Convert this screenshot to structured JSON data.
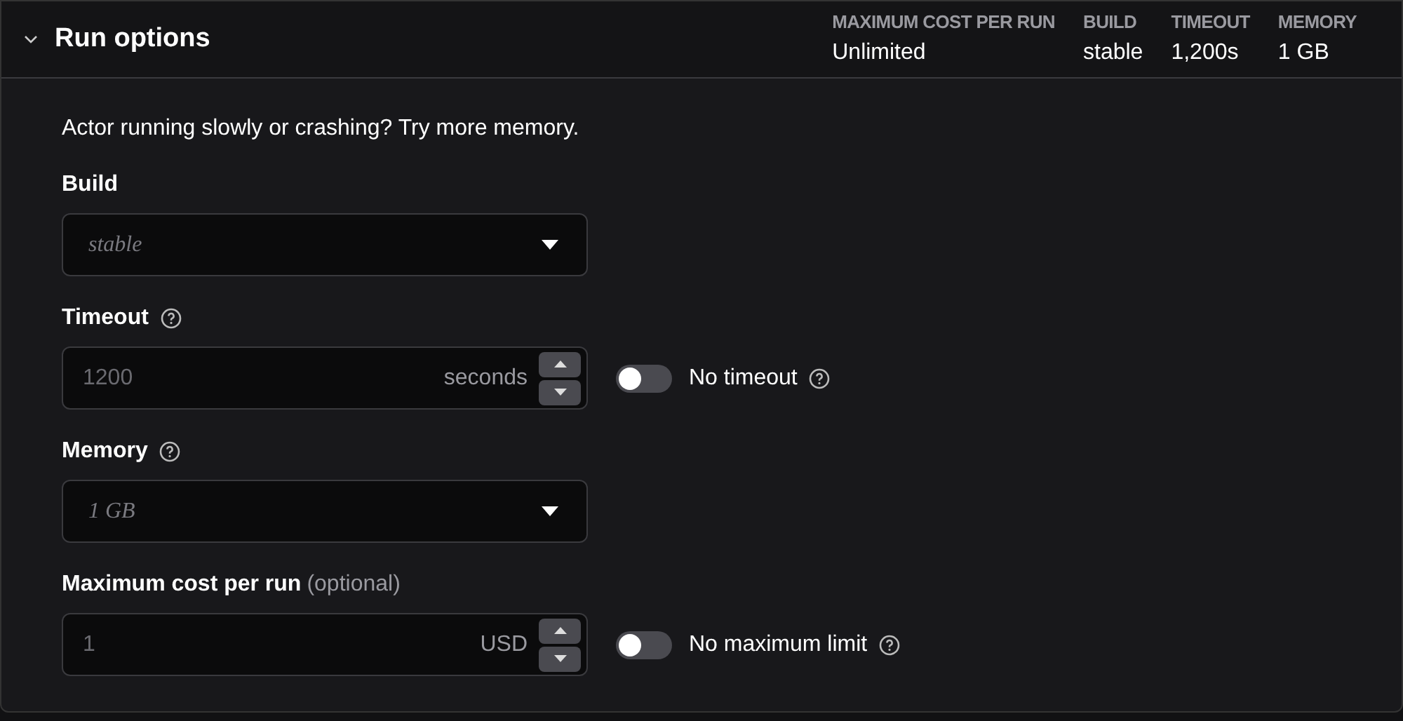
{
  "section": {
    "title": "Run options",
    "expanded": true,
    "summary": [
      {
        "label": "MAXIMUM COST PER RUN",
        "value": "Unlimited"
      },
      {
        "label": "BUILD",
        "value": "stable"
      },
      {
        "label": "TIMEOUT",
        "value": "1,200s"
      },
      {
        "label": "MEMORY",
        "value": "1 GB"
      }
    ]
  },
  "hint": "Actor running slowly or crashing? Try more memory.",
  "fields": [
    {
      "kind": "select",
      "label": "Build",
      "help": false,
      "placeholder": "stable"
    },
    {
      "kind": "number",
      "label": "Timeout",
      "help": true,
      "placeholder": "1200",
      "unit": "seconds",
      "toggle": {
        "label": "No timeout",
        "on": false,
        "help": true
      }
    },
    {
      "kind": "select",
      "label": "Memory",
      "help": true,
      "placeholder": "1 GB"
    },
    {
      "kind": "number",
      "label": "Maximum cost per run",
      "note": "(optional)",
      "help": false,
      "placeholder": "1",
      "unit": "USD",
      "toggle": {
        "label": "No maximum limit",
        "on": false,
        "help": true
      }
    }
  ]
}
